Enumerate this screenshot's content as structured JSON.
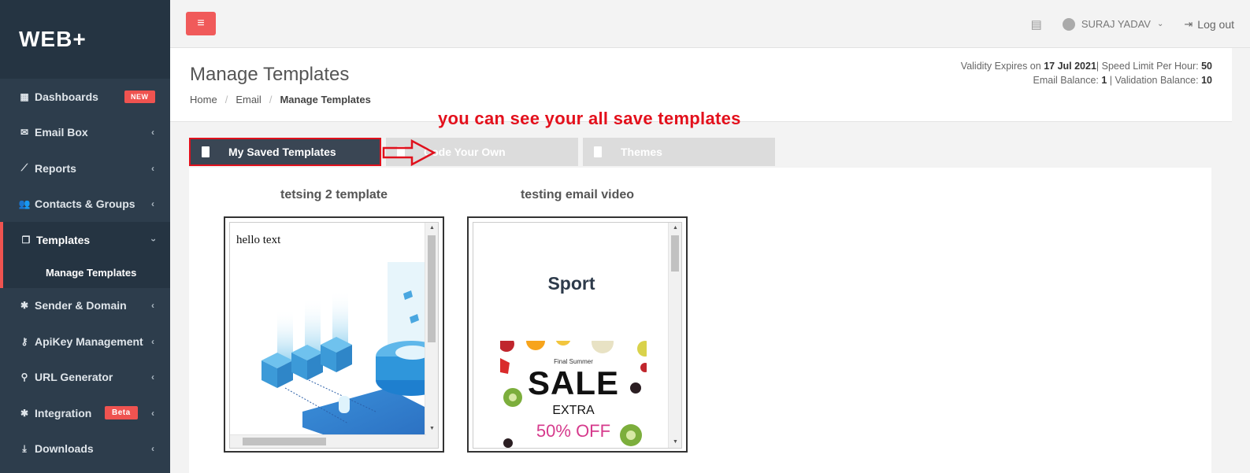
{
  "brand": "WEB+",
  "sidebar": {
    "items": [
      {
        "label": "Dashboards",
        "icon": "grid-icon",
        "badge": "NEW"
      },
      {
        "label": "Email Box",
        "icon": "envelope-icon"
      },
      {
        "label": "Reports",
        "icon": "line-chart-icon"
      },
      {
        "label": "Contacts & Groups",
        "icon": "users-icon"
      },
      {
        "label": "Templates",
        "icon": "copy-icon"
      },
      {
        "label": "Sender & Domain",
        "icon": "gear-icon"
      },
      {
        "label": "ApiKey Management",
        "icon": "key-icon"
      },
      {
        "label": "URL Generator",
        "icon": "link-icon"
      },
      {
        "label": "Integration",
        "icon": "cog-icon",
        "badge": "Beta"
      },
      {
        "label": "Downloads",
        "icon": "download-icon"
      }
    ],
    "sub_item": "Manage Templates"
  },
  "topbar": {
    "menu_icon": "hamburger-icon",
    "user_name": "SURAJ YADAV",
    "logout_label": "Log out"
  },
  "header": {
    "title": "Manage Templates",
    "breadcrumb": [
      "Home",
      "Email",
      "Manage Templates"
    ],
    "validity_prefix": "Validity Expires on",
    "validity_date": "17 Jul 2021",
    "speed_prefix": "| Speed Limit Per Hour:",
    "speed_value": "50",
    "email_balance_prefix": "Email Balance:",
    "email_balance_value": "1",
    "validation_prefix": "| Validation Balance:",
    "validation_value": "10"
  },
  "annotation": "you can see your all save templates",
  "tabs": [
    {
      "label": "My Saved Templates"
    },
    {
      "label": "Code Your Own"
    },
    {
      "label": "Themes"
    }
  ],
  "templates": [
    {
      "title": "tetsing 2 template",
      "preview_text": "hello text"
    },
    {
      "title": "testing email video",
      "preview_heading": "Sport",
      "sale": {
        "line1": "Final Summer",
        "line2": "SALE",
        "line3": "EXTRA",
        "line4": "50% OFF"
      }
    }
  ],
  "colors": {
    "accent": "#ef5350",
    "sidebar": "#2d3d4c",
    "annotation": "#e3101c",
    "sale_pink": "#d63a8c"
  }
}
